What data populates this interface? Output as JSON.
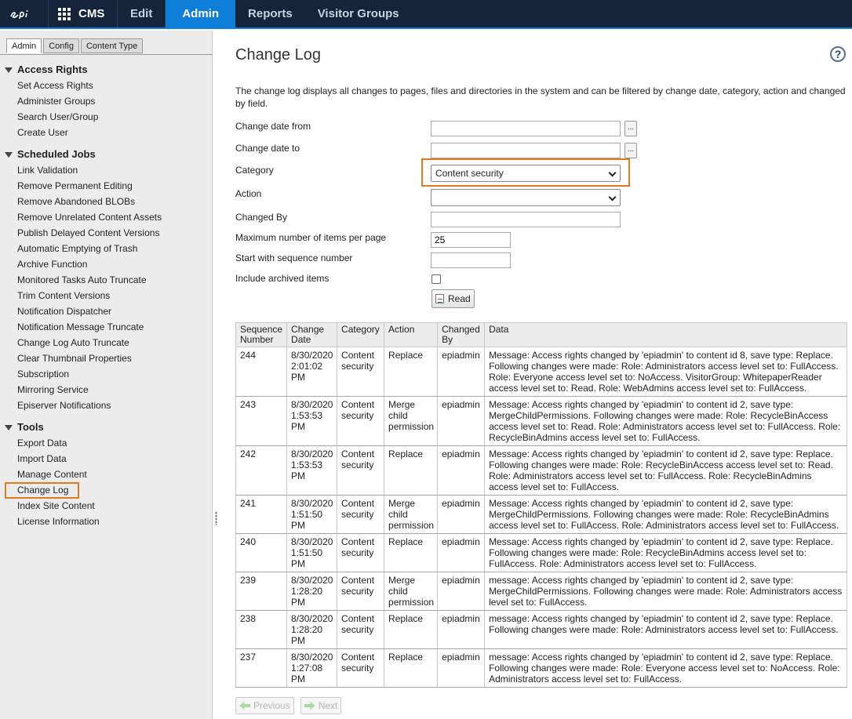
{
  "topbar": {
    "logo_alt": "epi",
    "app_name": "CMS",
    "nav": [
      "Edit",
      "Admin",
      "Reports",
      "Visitor Groups"
    ],
    "active_nav": "Admin"
  },
  "sidebar": {
    "tabs": [
      "Admin",
      "Config",
      "Content Type"
    ],
    "groups": [
      {
        "title": "Access Rights",
        "items": [
          "Set Access Rights",
          "Administer Groups",
          "Search User/Group",
          "Create User"
        ]
      },
      {
        "title": "Scheduled Jobs",
        "items": [
          "Link Validation",
          "Remove Permanent Editing",
          "Remove Abandoned BLOBs",
          "Remove Unrelated Content Assets",
          "Publish Delayed Content Versions",
          "Automatic Emptying of Trash",
          "Archive Function",
          "Monitored Tasks Auto Truncate",
          "Trim Content Versions",
          "Notification Dispatcher",
          "Notification Message Truncate",
          "Change Log Auto Truncate",
          "Clear Thumbnail Properties",
          "Subscription",
          "Mirroring Service",
          "Episerver Notifications"
        ]
      },
      {
        "title": "Tools",
        "items": [
          "Export Data",
          "Import Data",
          "Manage Content",
          "Change Log",
          "Index Site Content",
          "License Information"
        ]
      }
    ],
    "selected_item": "Change Log"
  },
  "main": {
    "title": "Change Log",
    "help": "?",
    "description": "The change log displays all changes to pages, files and directories in the system and can be filtered by change date, category, action and changed by field.",
    "form": {
      "change_date_from_label": "Change date from",
      "change_date_from_value": "",
      "change_date_to_label": "Change date to",
      "change_date_to_value": "",
      "picker_label": "...",
      "category_label": "Category",
      "category_value": "Content security",
      "action_label": "Action",
      "action_value": "",
      "changed_by_label": "Changed By",
      "changed_by_value": "",
      "max_items_label": "Maximum number of items per page",
      "max_items_value": "25",
      "start_seq_label": "Start with sequence number",
      "start_seq_value": "",
      "include_archived_label": "Include archived items",
      "read_button": "Read"
    },
    "table": {
      "headers": [
        "Sequence Number",
        "Change Date",
        "Category",
        "Action",
        "Changed By",
        "Data"
      ],
      "rows": [
        {
          "seq": "244",
          "date": "8/30/2020 2:01:02 PM",
          "category": "Content security",
          "action": "Replace",
          "by": "epiadmin",
          "data": "Message: Access rights changed by 'epiadmin' to content id 8, save type: Replace. Following changes were made: Role: Administrators access level set to: FullAccess. Role: Everyone access level set to: NoAccess. VisitorGroup: WhitepaperReader access level set to: Read. Role: WebAdmins access level set to: FullAccess."
        },
        {
          "seq": "243",
          "date": "8/30/2020 1:53:53 PM",
          "category": "Content security",
          "action": "Merge child permission",
          "by": "epiadmin",
          "data": "Message: Access rights changed by 'epiadmin' to content id 2, save type: MergeChildPermissions. Following changes were made: Role: RecycleBinAccess access level set to: Read. Role: Administrators access level set to: FullAccess. Role: RecycleBinAdmins access level set to: FullAccess."
        },
        {
          "seq": "242",
          "date": "8/30/2020 1:53:53 PM",
          "category": "Content security",
          "action": "Replace",
          "by": "epiadmin",
          "data": "Message: Access rights changed by 'epiadmin' to content id 2, save type: Replace. Following changes were made: Role: RecycleBinAccess access level set to: Read. Role: Administrators access level set to: FullAccess. Role: RecycleBinAdmins access level set to: FullAccess."
        },
        {
          "seq": "241",
          "date": "8/30/2020 1:51:50 PM",
          "category": "Content security",
          "action": "Merge child permission",
          "by": "epiadmin",
          "data": "Message: Access rights changed by 'epiadmin' to content id 2, save type: MergeChildPermissions. Following changes were made: Role: RecycleBinAdmins access level set to: FullAccess. Role: Administrators access level set to: FullAccess."
        },
        {
          "seq": "240",
          "date": "8/30/2020 1:51:50 PM",
          "category": "Content security",
          "action": "Replace",
          "by": "epiadmin",
          "data": "Message: Access rights changed by 'epiadmin' to content id 2, save type: Replace. Following changes were made: Role: RecycleBinAdmins access level set to: FullAccess. Role: Administrators access level set to: FullAccess."
        },
        {
          "seq": "239",
          "date": "8/30/2020 1:28:20 PM",
          "category": "Content security",
          "action": "Merge child permission",
          "by": "epiadmin",
          "data": "message: Access rights changed by 'epiadmin' to content id 2, save type: MergeChildPermissions. Following changes were made: Role: Administrators access level set to: FullAccess."
        },
        {
          "seq": "238",
          "date": "8/30/2020 1:28:20 PM",
          "category": "Content security",
          "action": "Replace",
          "by": "epiadmin",
          "data": "message: Access rights changed by 'epiadmin' to content id 2, save type: Replace. Following changes were made: Role: Administrators access level set to: FullAccess."
        },
        {
          "seq": "237",
          "date": "8/30/2020 1:27:08 PM",
          "category": "Content security",
          "action": "Replace",
          "by": "epiadmin",
          "data": "message: Access rights changed by 'epiadmin' to content id 2, save type: Replace. Following changes were made: Role: Everyone access level set to: NoAccess. Role: Administrators access level set to: FullAccess."
        }
      ]
    },
    "pager": {
      "previous": "Previous",
      "next": "Next"
    }
  },
  "colors": {
    "topbar_bg": "#15243b",
    "accent_blue": "#0e7fd8",
    "highlight_orange": "#e07a20"
  },
  "icons": [
    "episerver-logo-icon",
    "app-grid-icon",
    "help-icon",
    "calendar-picker-icon",
    "chevron-down-icon",
    "document-icon",
    "arrow-left-icon",
    "arrow-right-icon",
    "collapse-triangle-icon"
  ]
}
